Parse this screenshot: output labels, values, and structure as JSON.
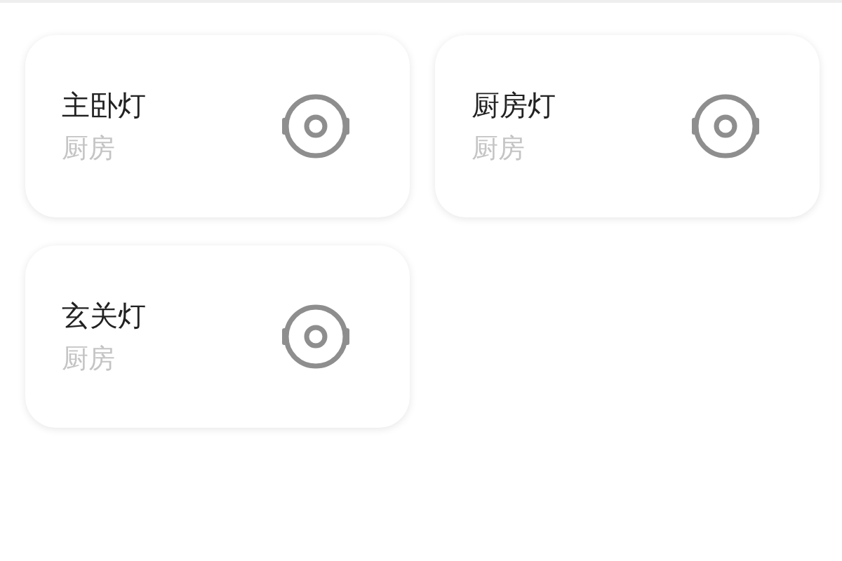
{
  "devices": [
    {
      "name": "主卧灯",
      "room": "厨房"
    },
    {
      "name": "厨房灯",
      "room": "厨房"
    },
    {
      "name": "玄关灯",
      "room": "厨房"
    }
  ]
}
